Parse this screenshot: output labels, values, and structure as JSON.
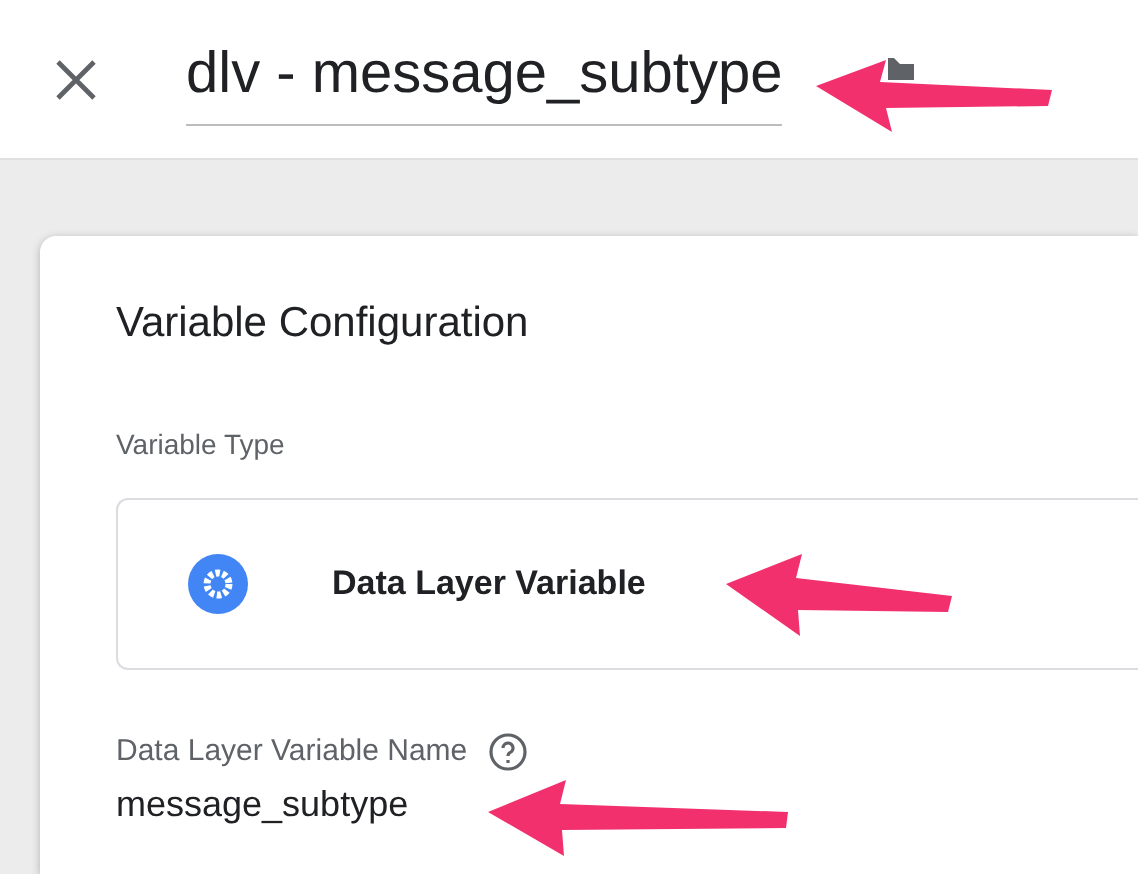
{
  "header": {
    "title": "dlv - message_subtype"
  },
  "card": {
    "title": "Variable Configuration",
    "variable_type": {
      "label": "Variable Type",
      "value": "Data Layer Variable"
    },
    "name_field": {
      "label": "Data Layer Variable Name",
      "value": "message_subtype"
    }
  }
}
